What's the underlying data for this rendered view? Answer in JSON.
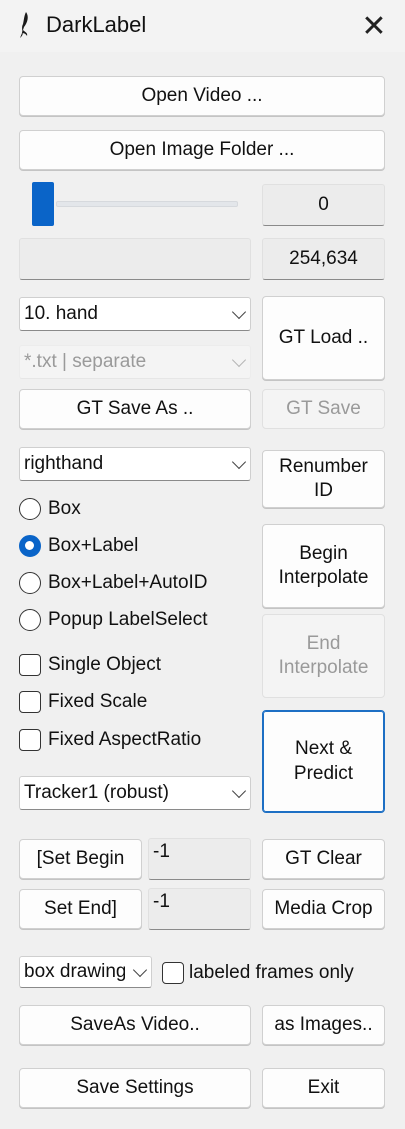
{
  "window": {
    "title": "DarkLabel",
    "icon": "app-feather-icon",
    "close_icon": "close-icon"
  },
  "video": {
    "open_video": "Open Video ...",
    "open_image_folder": "Open Image Folder ..."
  },
  "frame": {
    "current": "0",
    "total": "254,634",
    "info": "",
    "slider_position": 0
  },
  "gt": {
    "preset": "10. hand",
    "format": "*.txt | separate",
    "load": "GT Load ..",
    "save_as": "GT Save As ..",
    "save": "GT Save"
  },
  "label": {
    "class_value": "righthand"
  },
  "modes": {
    "box": "Box",
    "box_label": "Box+Label",
    "box_label_autoid": "Box+Label+AutoID",
    "popup": "Popup LabelSelect",
    "selected": "Box+Label"
  },
  "options": {
    "single_object": "Single Object",
    "fixed_scale": "Fixed Scale",
    "fixed_aspect": "Fixed AspectRatio"
  },
  "actions": {
    "renumber": "Renumber ID",
    "begin_interp": "Begin Interpolate",
    "end_interp": "End Interpolate",
    "next_predict": "Next & Predict"
  },
  "tracker": {
    "value": "Tracker1 (robust)"
  },
  "range": {
    "set_begin": "[Set Begin",
    "begin_value": "-1",
    "set_end": "Set End]",
    "end_value": "-1",
    "gt_clear": "GT Clear",
    "media_crop": "Media Crop"
  },
  "output": {
    "draw_mode": "box drawing",
    "labeled_only": "labeled frames only",
    "save_video": "SaveAs Video..",
    "as_images": "as Images.."
  },
  "footer": {
    "save_settings": "Save Settings",
    "exit": "Exit"
  },
  "colors": {
    "accent": "#0a64c8",
    "background": "#f0f0f0"
  }
}
